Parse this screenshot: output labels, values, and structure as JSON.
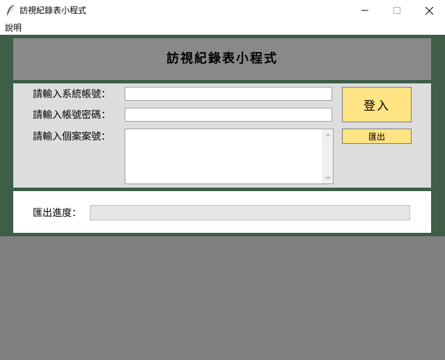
{
  "window": {
    "title": "訪視紀錄表小程式",
    "icon": "feather-icon",
    "controls": [
      "minimize-icon",
      "maximize-icon",
      "close-icon"
    ]
  },
  "menu": {
    "items": [
      "說明"
    ]
  },
  "header": {
    "title": "訪視紀錄表小程式"
  },
  "form": {
    "account_label": "請輸入系統帳號：",
    "account_value": "",
    "password_label": "請輸入帳號密碼：",
    "password_value": "",
    "case_label": "請輸入個案案號：",
    "case_value": ""
  },
  "buttons": {
    "login": "登入",
    "export": "匯出"
  },
  "progress": {
    "label": "匯出進度：",
    "value": 0
  },
  "colors": {
    "client_background": "#3f5e48",
    "header_background": "#898989",
    "form_background": "#dddddd",
    "button_yellow": "#ffe384",
    "outside_gray": "#808080"
  }
}
